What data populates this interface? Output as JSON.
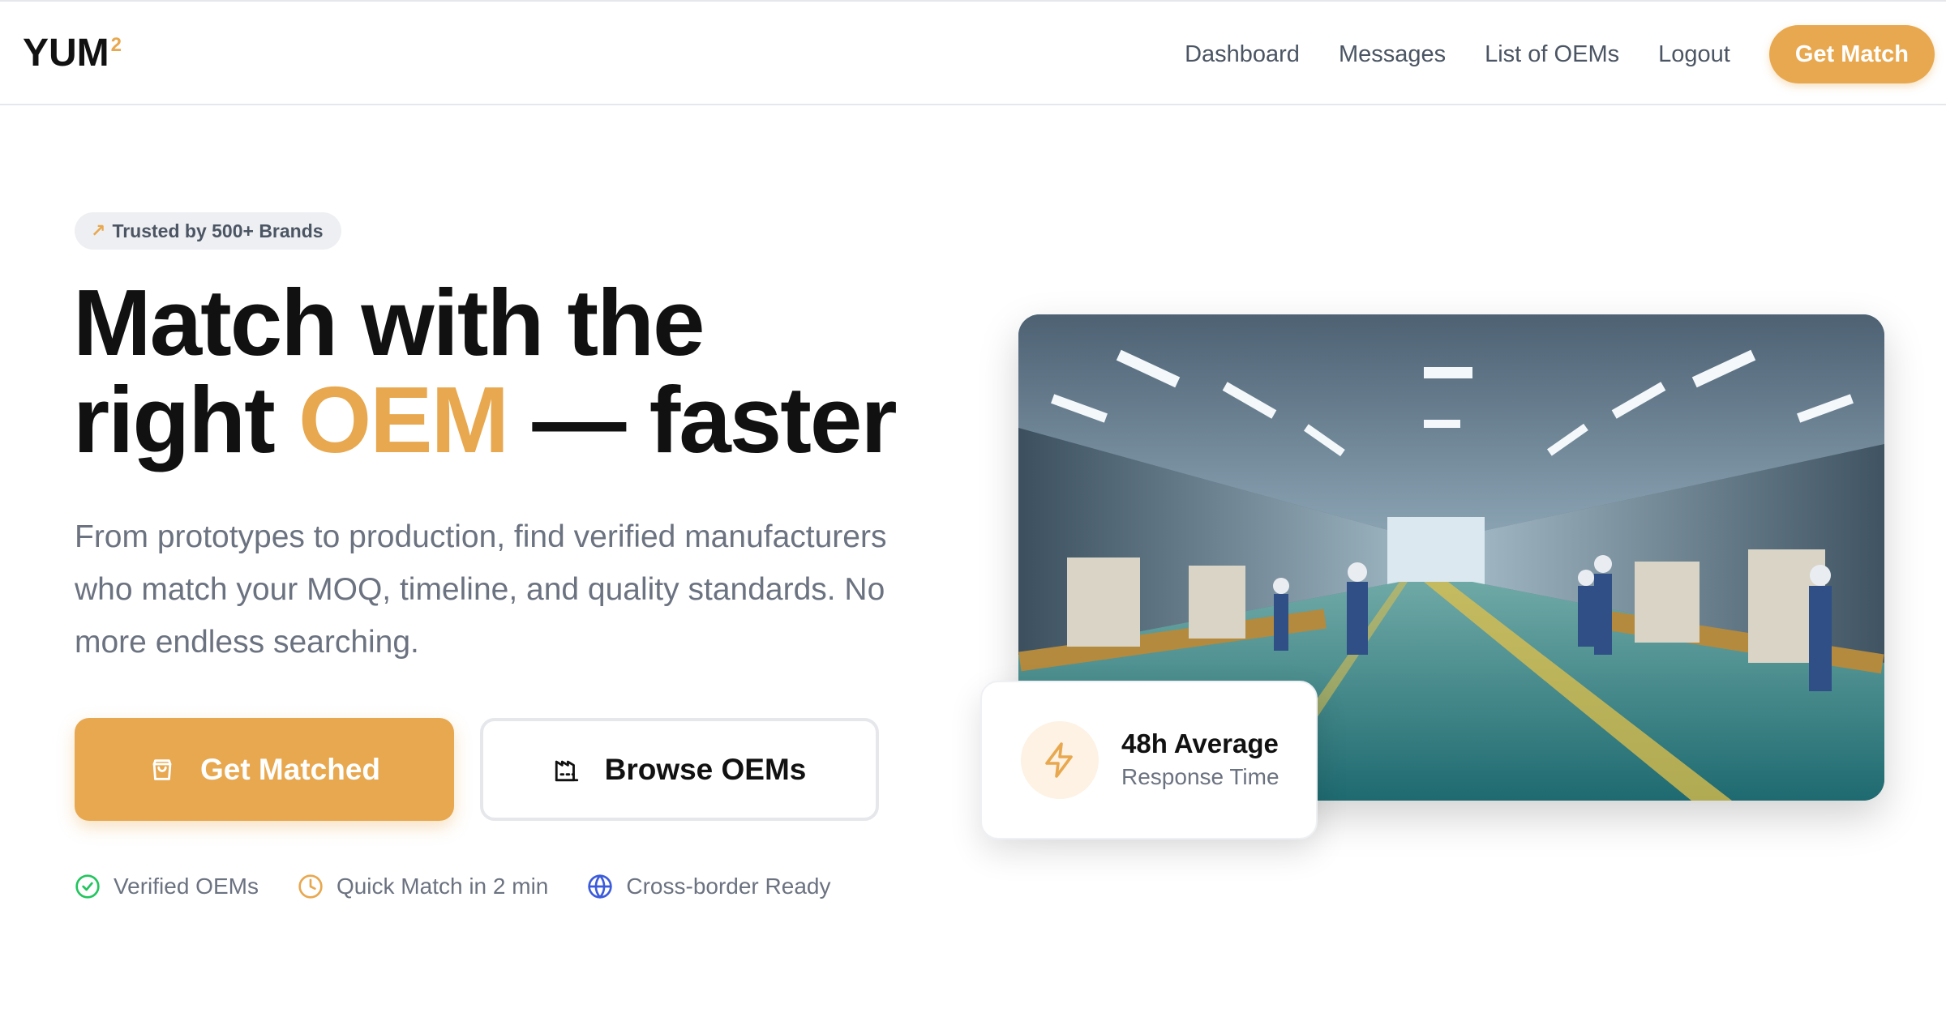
{
  "header": {
    "logo_text": "YUM",
    "logo_superscript": "2",
    "nav": [
      {
        "label": "Dashboard"
      },
      {
        "label": "Messages"
      },
      {
        "label": "List of OEMs"
      },
      {
        "label": "Logout"
      }
    ],
    "cta_label": "Get Match"
  },
  "hero": {
    "badge": {
      "icon": "rocket-icon",
      "text": "Trusted by 500+ Brands"
    },
    "title": {
      "line1": "Match with the",
      "line2_prefix": "right",
      "line2_accent": "OEM",
      "line2_suffix": "— faster"
    },
    "subtitle": "From prototypes to production, find verified manufacturers who match your MOQ, timeline, and quality standards. No more endless searching.",
    "primary_button": {
      "icon": "shopping-bag-icon",
      "label": "Get Matched"
    },
    "secondary_button": {
      "icon": "factory-icon",
      "label": "Browse OEMs"
    },
    "features": [
      {
        "icon": "check-circle-icon",
        "label": "Verified OEMs",
        "color": "#22c55e"
      },
      {
        "icon": "clock-icon",
        "label": "Quick Match in 2 min",
        "color": "#e8a84f"
      },
      {
        "icon": "globe-icon",
        "label": "Cross-border Ready",
        "color": "#3b5bdb"
      }
    ]
  },
  "image": {
    "subject": "factory-floor-photo"
  },
  "stat_card": {
    "icon": "lightning-icon",
    "value": "48h Average",
    "label": "Response Time"
  },
  "colors": {
    "accent": "#e8a84f",
    "text_dark": "#111111",
    "text_muted": "#6b7280",
    "border": "#e5e7eb"
  }
}
